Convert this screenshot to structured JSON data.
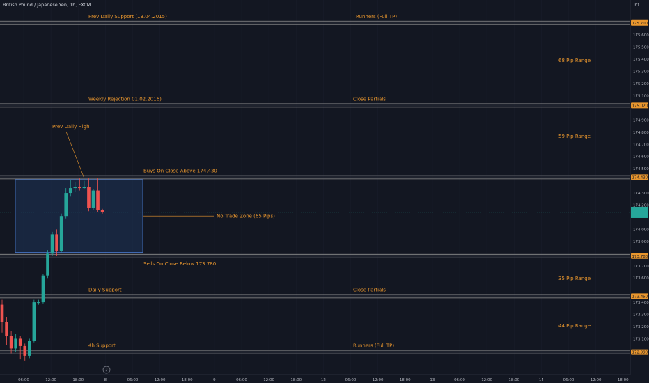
{
  "chart_data": {
    "type": "candlestick",
    "title": "British Pound / Japanese Yen, 1h, FXCM",
    "currency": "JPY",
    "ylim": [
      172.955,
      175.805
    ],
    "y_ticks": [
      "175.600",
      "175.500",
      "175.400",
      "175.300",
      "175.200",
      "175.100",
      "174.900",
      "174.800",
      "174.700",
      "174.600",
      "174.500",
      "174.300",
      "174.200",
      "174.000",
      "173.900",
      "173.700",
      "173.600",
      "173.400",
      "173.300",
      "173.200",
      "173.100"
    ],
    "x_ticks": [
      "06:00",
      "12:00",
      "18:00",
      "8",
      "06:00",
      "12:00",
      "18:00",
      "9",
      "06:00",
      "12:00",
      "18:00",
      "12",
      "06:00",
      "12:00",
      "18:00",
      "13",
      "06:00",
      "12:00",
      "18:00",
      "14",
      "06:00",
      "12:00",
      "18:00"
    ],
    "levels": [
      {
        "price": 175.7,
        "label": "175.700",
        "left_text": "Prev Daily Support (13.04.2015)",
        "mid_text": "Runners (Full TP)"
      },
      {
        "price": 175.02,
        "label": "175.020",
        "left_text": "Weekly Rejection 01.02.2016)",
        "mid_text": "Close Partials"
      },
      {
        "price": 174.43,
        "label": "174.430",
        "left_text": "Buys On Close Above 174.430",
        "mid_text": ""
      },
      {
        "price": 173.78,
        "label": "173.780",
        "left_text": "Sells On Close Below 173.780",
        "mid_text": ""
      },
      {
        "price": 173.45,
        "label": "173.450",
        "left_text": "Daily Support",
        "mid_text": "Close Partials"
      },
      {
        "price": 172.99,
        "label": "172.990",
        "left_text": "4h Support",
        "mid_text": "Runners (Full TP)"
      }
    ],
    "ranges": [
      "68 Pip Range",
      "59 Pip Range",
      "35 Pip Range",
      "44 Pip Range"
    ],
    "zone": {
      "label": "No Trade Zone (65 Pips)",
      "high": 174.41,
      "low": 173.81
    },
    "prev_daily_high_label": "Prev Daily High",
    "current_price": 174.14,
    "candles": [
      {
        "o": 173.38,
        "h": 173.42,
        "l": 173.15,
        "c": 173.24
      },
      {
        "o": 173.24,
        "h": 173.28,
        "l": 173.05,
        "c": 173.12
      },
      {
        "o": 173.12,
        "h": 173.16,
        "l": 172.98,
        "c": 173.02
      },
      {
        "o": 173.02,
        "h": 173.14,
        "l": 172.99,
        "c": 173.1
      },
      {
        "o": 173.1,
        "h": 173.12,
        "l": 172.93,
        "c": 173.04
      },
      {
        "o": 173.04,
        "h": 173.06,
        "l": 172.92,
        "c": 172.96
      },
      {
        "o": 172.96,
        "h": 173.1,
        "l": 172.94,
        "c": 173.08
      },
      {
        "o": 173.08,
        "h": 173.42,
        "l": 173.07,
        "c": 173.4
      },
      {
        "o": 173.4,
        "h": 173.42,
        "l": 173.38,
        "c": 173.4
      },
      {
        "o": 173.4,
        "h": 173.63,
        "l": 173.39,
        "c": 173.62
      },
      {
        "o": 173.62,
        "h": 173.83,
        "l": 173.6,
        "c": 173.8
      },
      {
        "o": 173.8,
        "h": 173.98,
        "l": 173.78,
        "c": 173.96
      },
      {
        "o": 173.96,
        "h": 174.0,
        "l": 173.78,
        "c": 173.82
      },
      {
        "o": 173.82,
        "h": 174.13,
        "l": 173.81,
        "c": 174.11
      },
      {
        "o": 174.11,
        "h": 174.34,
        "l": 174.09,
        "c": 174.3
      },
      {
        "o": 174.3,
        "h": 174.41,
        "l": 174.27,
        "c": 174.34
      },
      {
        "o": 174.34,
        "h": 174.39,
        "l": 174.31,
        "c": 174.35
      },
      {
        "o": 174.35,
        "h": 174.42,
        "l": 174.32,
        "c": 174.34
      },
      {
        "o": 174.34,
        "h": 174.4,
        "l": 174.33,
        "c": 174.35
      },
      {
        "o": 174.35,
        "h": 174.42,
        "l": 174.15,
        "c": 174.18
      },
      {
        "o": 174.18,
        "h": 174.33,
        "l": 174.16,
        "c": 174.32
      },
      {
        "o": 174.32,
        "h": 174.42,
        "l": 174.14,
        "c": 174.16
      },
      {
        "o": 174.16,
        "h": 174.17,
        "l": 174.13,
        "c": 174.14
      }
    ]
  },
  "colors": {
    "background": "#131722",
    "bull": "#26a69a",
    "bear": "#ef5350",
    "level": "#8c8c8c",
    "annotation": "#e8962e",
    "zone_fill": "#1d3358",
    "zone_border": "#4a7bd0",
    "axis_text": "#b2b5be"
  }
}
